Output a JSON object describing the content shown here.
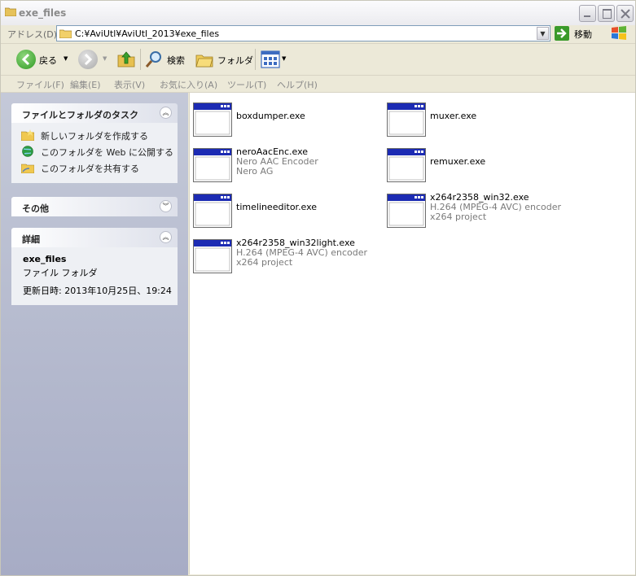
{
  "window": {
    "title": "exe_files",
    "controls": [
      "minimize-icon",
      "maximize-icon",
      "close-icon"
    ]
  },
  "address": {
    "label": "アドレス(D)",
    "path": "C:¥AviUtl¥AviUtl_2013¥exe_files",
    "go_label": "移動"
  },
  "toolbar": {
    "back_label": "戻る",
    "search_label": "検索",
    "folders_label": "フォルダ"
  },
  "menu": [
    "ファイル(F)",
    "編集(E)",
    "表示(V)",
    "お気に入り(A)",
    "ツール(T)",
    "ヘルプ(H)"
  ],
  "sidebar": {
    "tasks": {
      "title": "ファイルとフォルダのタスク",
      "items": [
        "新しいフォルダを作成する",
        "このフォルダを Web に公開する",
        "このフォルダを共有する"
      ]
    },
    "other": {
      "title": "その他"
    },
    "details": {
      "title": "詳細",
      "name": "exe_files",
      "type": "ファイル フォルダ",
      "modified": "更新日時: 2013年10月25日、19:24"
    }
  },
  "files": [
    {
      "name": "boxdumper.exe",
      "desc": "",
      "company": ""
    },
    {
      "name": "muxer.exe",
      "desc": "",
      "company": ""
    },
    {
      "name": "neroAacEnc.exe",
      "desc": "Nero AAC Encoder",
      "company": "Nero AG"
    },
    {
      "name": "remuxer.exe",
      "desc": "",
      "company": ""
    },
    {
      "name": "timelineeditor.exe",
      "desc": "",
      "company": ""
    },
    {
      "name": "x264r2358_win32.exe",
      "desc": "H.264 (MPEG-4 AVC) encoder",
      "company": "x264 project"
    },
    {
      "name": "x264r2358_win32light.exe",
      "desc": "H.264 (MPEG-4 AVC) encoder",
      "company": "x264 project"
    }
  ],
  "colors": {
    "pane_top": "#c4c9d8",
    "pane_bottom": "#a7acc5",
    "exe_titlebar": "#1c2bb3"
  }
}
